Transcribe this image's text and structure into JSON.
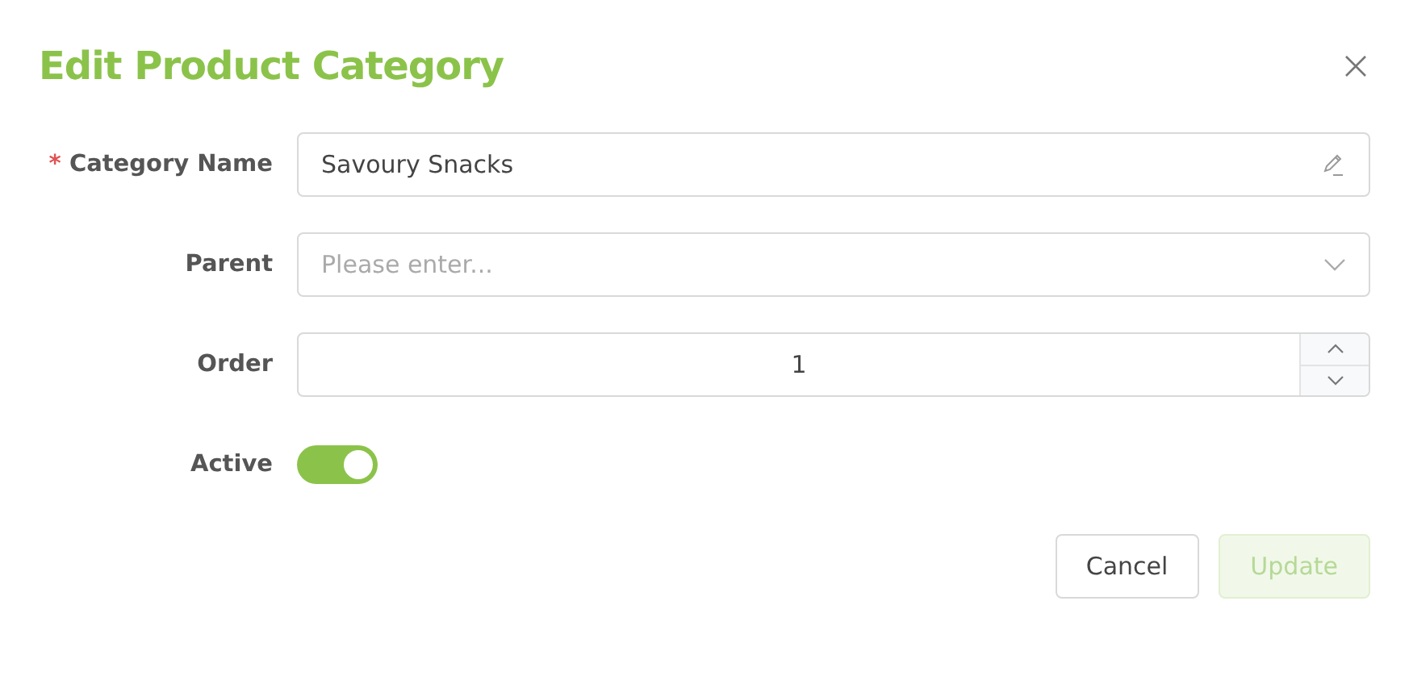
{
  "dialog": {
    "title": "Edit Product Category",
    "required_mark": "*"
  },
  "fields": [
    {
      "kind": "text",
      "label": "Category Name",
      "required": true,
      "value": "Savoury Snacks"
    },
    {
      "kind": "select",
      "label": "Parent",
      "required": false,
      "placeholder": "Please enter..."
    },
    {
      "kind": "number",
      "label": "Order",
      "required": false,
      "value": "1"
    },
    {
      "kind": "switch",
      "label": "Active",
      "required": false,
      "on": true
    }
  ],
  "buttons": [
    {
      "label": "Cancel",
      "kind": "default",
      "disabled": false
    },
    {
      "label": "Update",
      "kind": "primary",
      "disabled": true
    }
  ]
}
